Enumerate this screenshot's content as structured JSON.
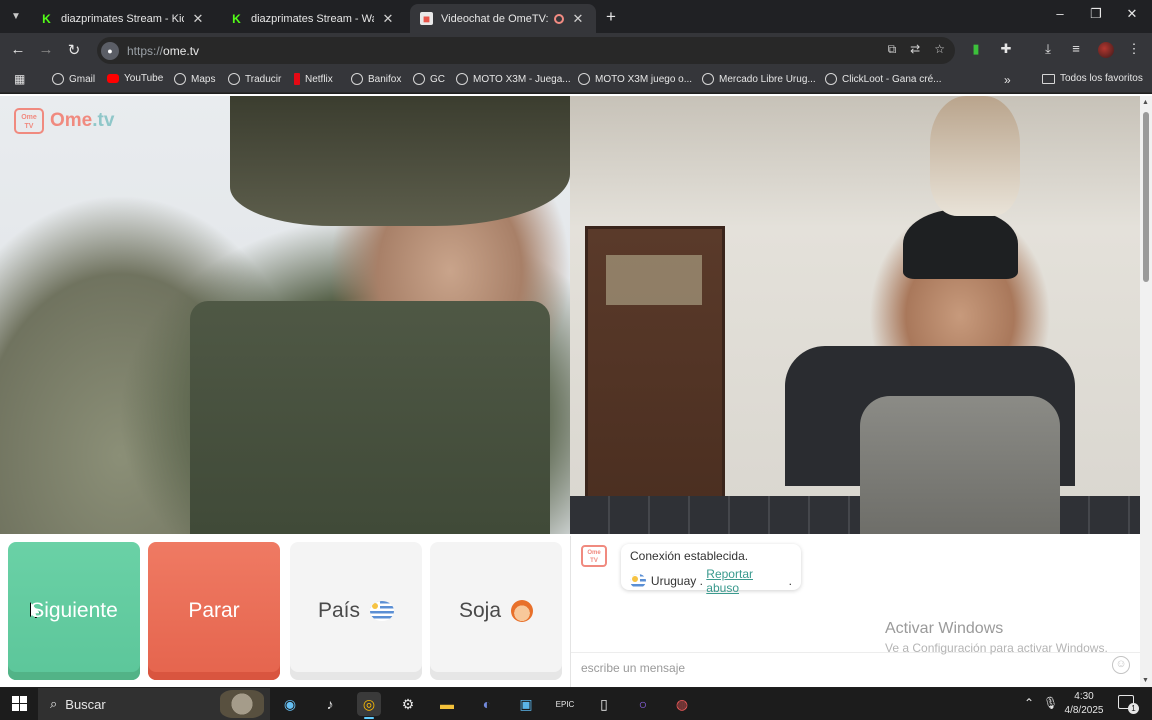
{
  "browser": {
    "tabs": [
      {
        "title": "diazprimates Stream - Kick Dashboard",
        "favicon": "kick-icon",
        "active": false
      },
      {
        "title": "diazprimates Stream - Watch Live",
        "favicon": "kick-icon",
        "active": false
      },
      {
        "title": "Videochat de OmeTV: una alternativa",
        "favicon": "ometv-icon",
        "active": true,
        "recording": true
      }
    ],
    "new_tab_label": "+",
    "window_controls": {
      "minimize": "–",
      "restore": "❐",
      "close": "✕"
    },
    "omnibox": {
      "scheme": "https://",
      "host": "ome.tv"
    },
    "bookmarks": [
      {
        "label": "Gmail",
        "icon": "globe-icon"
      },
      {
        "label": "YouTube",
        "icon": "youtube-icon"
      },
      {
        "label": "Maps",
        "icon": "globe-icon"
      },
      {
        "label": "Traducir",
        "icon": "globe-icon"
      },
      {
        "label": "Netflix",
        "icon": "netflix-icon"
      },
      {
        "label": "Banifox",
        "icon": "globe-icon"
      },
      {
        "label": "GC",
        "icon": "globe-icon"
      },
      {
        "label": "MOTO X3M - Juega...",
        "icon": "globe-icon"
      },
      {
        "label": "MOTO X3M juego o...",
        "icon": "globe-icon"
      },
      {
        "label": "Mercado Libre Urug...",
        "icon": "globe-icon"
      },
      {
        "label": "ClickLoot - Gana cré...",
        "icon": "globe-icon"
      }
    ],
    "bookmarks_more": "»",
    "all_bookmarks": "Todos los favoritos"
  },
  "page": {
    "logo": {
      "badge_top": "Ome",
      "badge_bottom": "TV",
      "name_main": "Ome",
      "name_suffix": ".tv"
    },
    "buttons": {
      "next": "Siguiente",
      "stop": "Parar",
      "country": "País",
      "gender": "Soja"
    },
    "chat": {
      "logo_top": "Ome",
      "logo_bottom": "TV",
      "status": "Conexión establecida.",
      "country": "Uruguay",
      "separator": " . ",
      "report_link": "Reportar abuso",
      "report_end": ".",
      "placeholder": "escribe un mensaje"
    },
    "watermark": {
      "title": "Activar Windows",
      "subtitle": "Ve a Configuración para activar Windows."
    }
  },
  "taskbar": {
    "search_label": "Buscar",
    "time": "4:30",
    "date": "4/8/2025",
    "notification_count": "1"
  },
  "colors": {
    "next_button": "#5cc69a",
    "stop_button": "#e5644d",
    "ometv_brand": "#f08a7f",
    "link": "#3a9a8e"
  }
}
